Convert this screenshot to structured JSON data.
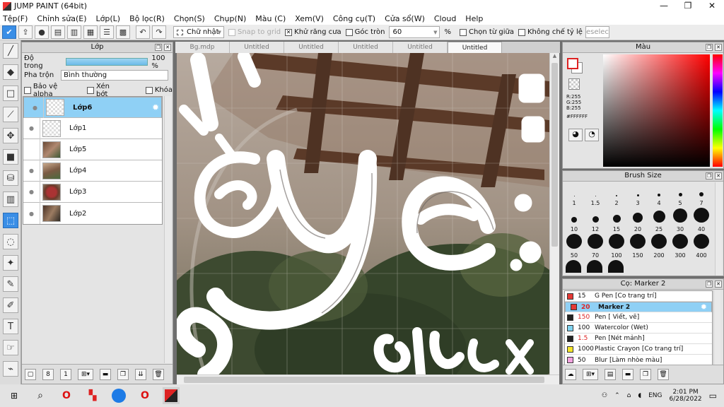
{
  "window": {
    "title": "JUMP PAINT (64bit)"
  },
  "menu": [
    "Tệp(F)",
    "Chỉnh sửa(E)",
    "Lớp(L)",
    "Bộ lọc(R)",
    "Chọn(S)",
    "Chụp(N)",
    "Màu (C)",
    "Xem(V)",
    "Công cụ(T)",
    "Cửa sổ(W)",
    "Cloud",
    "Help"
  ],
  "toolbar": {
    "shape": "Chữ nhật",
    "snap": "Snap to grid",
    "antialias": "Khử răng cưa",
    "round": "Góc tròn",
    "round_value": "60",
    "percent": "%",
    "from_center": "Chọn từ giữa",
    "fixed_ratio": "Không chế tỷ lệ",
    "deselect": "eselec"
  },
  "layer_panel": {
    "title": "Lớp",
    "opacity_label": "Độ trong",
    "opacity_value": "100 %",
    "opacity": 1.0,
    "blend_label": "Pha trộn",
    "blend_value": "Bình thường",
    "protect_alpha": "Bảo vệ alpha",
    "clip": "Xén bớt",
    "lock": "Khóa",
    "layers": [
      "Lớp6",
      "Lớp1",
      "Lớp5",
      "Lớp4",
      "Lớp3",
      "Lớp2"
    ]
  },
  "tabs": [
    "Bg.mdp",
    "Untitled",
    "Untitled",
    "Untitled",
    "Untitled",
    "Untitled"
  ],
  "color_panel": {
    "title": "Màu",
    "r": "R:255",
    "g": "G:255",
    "b": "B:255",
    "hex": "#FFFFFF"
  },
  "brush_panel": {
    "title": "Brush Size",
    "sizes": [
      "1",
      "1.5",
      "2",
      "3",
      "4",
      "5",
      "7",
      "10",
      "12",
      "15",
      "20",
      "25",
      "30",
      "40",
      "50",
      "70",
      "100",
      "150",
      "200",
      "300",
      "400"
    ]
  },
  "marker_panel": {
    "title": "Cọ: Marker 2",
    "items": [
      {
        "size": "15",
        "name": "G Pen [Co trang trí]",
        "color": "#e53935"
      },
      {
        "size": "20",
        "name": "Marker 2",
        "color": "#e53935"
      },
      {
        "size": "150",
        "name": "Pen [ Viết, vẽ]",
        "color": "#222222"
      },
      {
        "size": "100",
        "name": "Watercolor (Wet)",
        "color": "#7fd3f0"
      },
      {
        "size": "1.5",
        "name": "Pen [Nét mảnh]",
        "color": "#222222"
      },
      {
        "size": "1000",
        "name": "Plastic Crayon [Co trang trí]",
        "color": "#f5e52a"
      },
      {
        "size": "50",
        "name": "Blur [Làm nhòe màu]",
        "color": "#f4a3e0"
      }
    ]
  },
  "taskbar": {
    "lang": "ENG",
    "time": "2:01 PM",
    "date": "6/28/2022"
  }
}
